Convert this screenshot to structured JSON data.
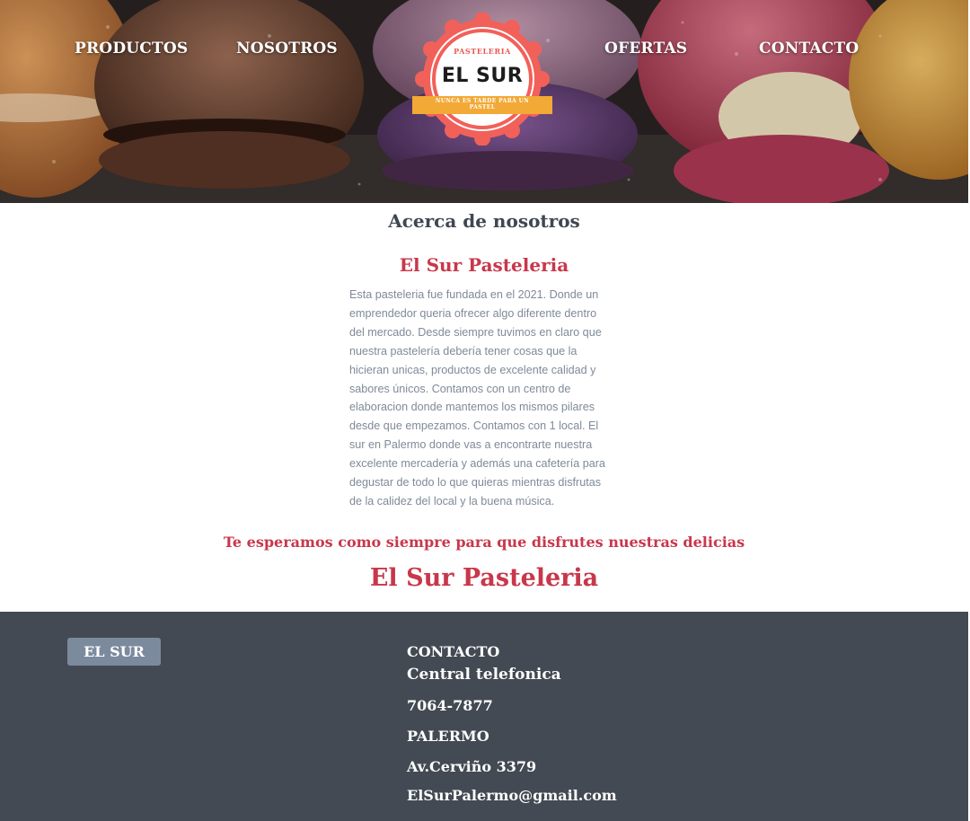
{
  "nav": {
    "items": [
      "PRODUCTOS",
      "NOSOTROS",
      "OFERTAS",
      "CONTACTO"
    ]
  },
  "logo": {
    "top_text": "PASTELERIA",
    "name": "EL SUR",
    "ribbon_line1": "NUNCA ES TARDE PARA UN",
    "ribbon_line2": "PASTEL"
  },
  "about": {
    "title": "Acerca de nosotros",
    "subtitle": "El Sur Pasteleria",
    "lines": [
      "Esta pasteleria fue fundada en el 2021. Donde un",
      "emprendedor queria ofrecer algo diferente dentro",
      "del mercado. Desde siempre tuvimos en claro que",
      "nuestra pastelería debería tener cosas que la",
      "hicieran unicas, productos de excelente calidad y",
      "sabores únicos. Contamos con un centro de",
      "elaboracion donde mantemos los mismos pilares",
      "desde que empezamos. Contamos con 1 local. El",
      "sur en Palermo donde vas a encontrarte nuestra",
      "excelente mercadería y además una cafetería para",
      "degustar de todo lo que quieras mientras disfrutas",
      "de la calidez del local y la buena música."
    ],
    "tagline": "Te esperamos como siempre para que disfrutes nuestras delicias",
    "brand": "El Sur Pasteleria"
  },
  "footer": {
    "badge": "EL SUR",
    "heading": "CONTACTO",
    "subheading": "Central telefonica",
    "phone": "7064-7877",
    "city": "PALERMO",
    "address": "Av.Cerviño 3379",
    "email": "ElSurPalermo@gmail.com"
  },
  "colors": {
    "brand_red": "#c8374a",
    "title_gray": "#3f4752",
    "footer_bg": "#434a53",
    "badge_bg": "#7c8a9e",
    "ribbon": "#f2a936",
    "logo_ring": "#f2605a"
  }
}
